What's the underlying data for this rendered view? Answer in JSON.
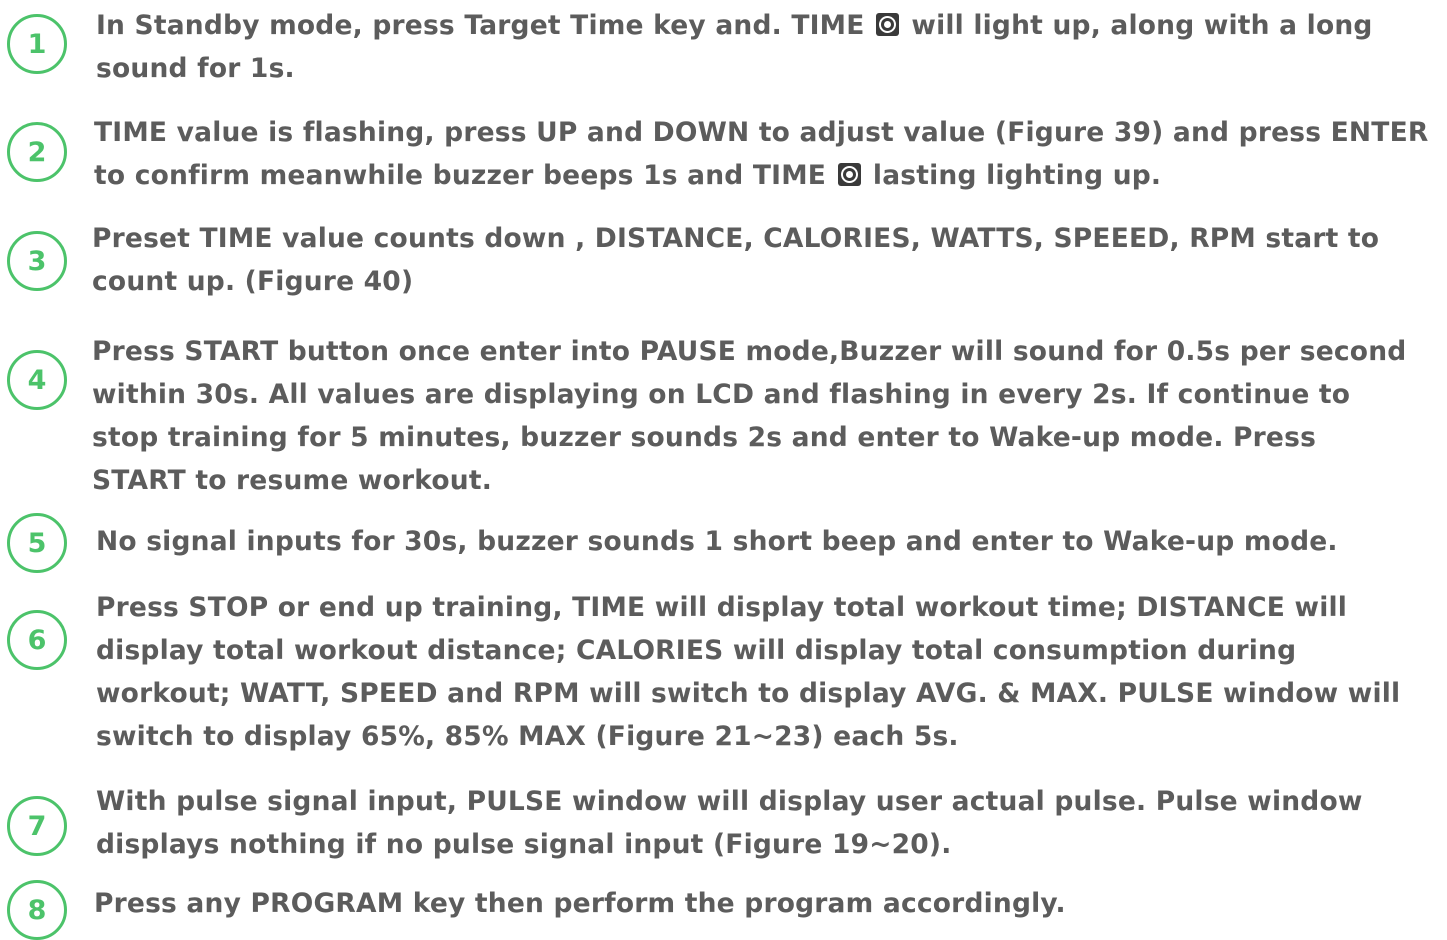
{
  "steps": [
    {
      "number": "1",
      "lines": [
        [
          "In Standby mode, press Target Time key and. TIME ",
          " will light up, along with a long"
        ],
        [
          "sound for 1s."
        ]
      ]
    },
    {
      "number": "2",
      "lines": [
        [
          "TIME value is flashing, press UP and DOWN to adjust value (Figure 39) and press ENTER"
        ],
        [
          "to confirm meanwhile buzzer beeps 1s and TIME ",
          " lasting lighting up."
        ]
      ]
    },
    {
      "number": "3",
      "lines": [
        [
          "Preset TIME value counts down , DISTANCE, CALORIES, WATTS, SPEEED,  RPM start to"
        ],
        [
          "count up. (Figure 40)"
        ]
      ]
    },
    {
      "number": "4",
      "lines": [
        [
          "Press START button once enter into PAUSE mode,Buzzer will sound for 0.5s per second"
        ],
        [
          "within 30s. All values are displaying on LCD and flashing in every 2s. If continue to"
        ],
        [
          "stop training for 5 minutes, buzzer sounds 2s and enter to Wake-up mode. Press"
        ],
        [
          "START to resume workout."
        ]
      ]
    },
    {
      "number": "5",
      "lines": [
        [
          "No signal inputs for 30s, buzzer sounds 1 short beep and enter to Wake-up mode."
        ]
      ]
    },
    {
      "number": "6",
      "lines": [
        [
          "Press STOP or end up training, TIME will display total workout time; DISTANCE will"
        ],
        [
          "display total workout distance; CALORIES will display total consumption during"
        ],
        [
          "workout; WATT, SPEED and RPM will switch to display AVG. & MAX. PULSE window will"
        ],
        [
          "switch to display 65%, 85% MAX (Figure 21~23) each 5s."
        ]
      ]
    },
    {
      "number": "7",
      "lines": [
        [
          "With pulse signal input, PULSE window will display user actual pulse. Pulse window"
        ],
        [
          "displays nothing if no pulse signal input (Figure 19~20)."
        ]
      ]
    },
    {
      "number": "8",
      "lines": [
        [
          "Press any PROGRAM key then perform the program accordingly."
        ]
      ]
    }
  ],
  "colors": {
    "badge": "#4cc36a",
    "text": "#5c5c5c"
  },
  "icons": {
    "time_indicator": "target-time-icon"
  }
}
